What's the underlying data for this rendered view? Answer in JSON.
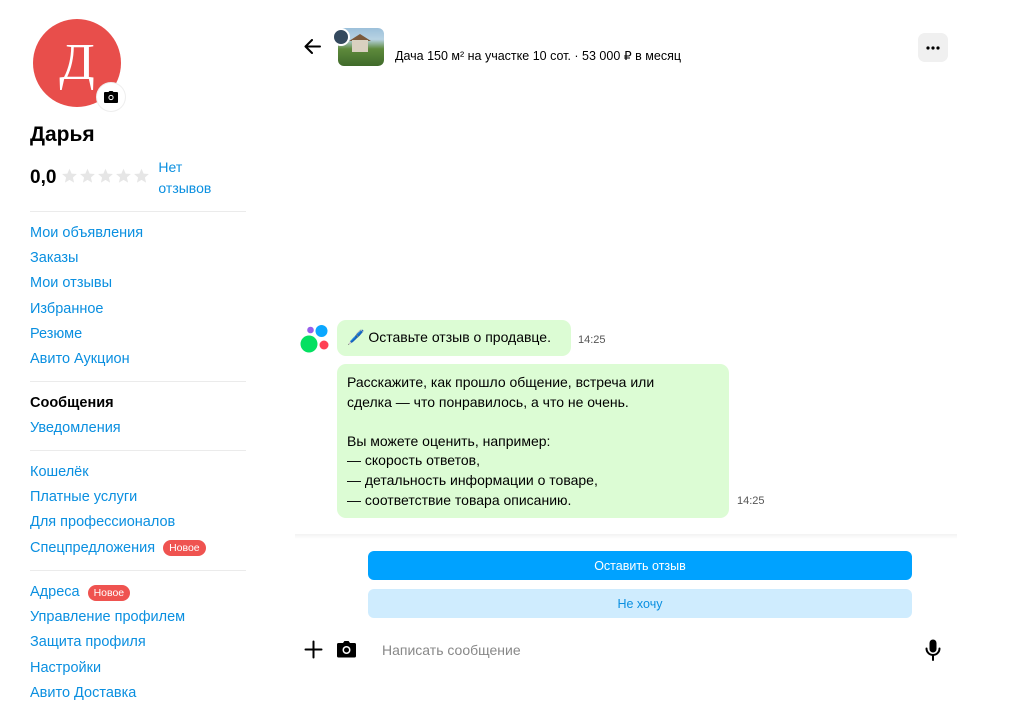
{
  "profile": {
    "avatar_letter": "Д",
    "name": "Дарья",
    "rating": "0,0",
    "stars_filled": 0,
    "stars_total": 5,
    "no_reviews": "Нет отзывов"
  },
  "menu": {
    "group1": [
      "Мои объявления",
      "Заказы",
      "Мои отзывы",
      "Избранное",
      "Резюме",
      "Авито Аукцион"
    ],
    "group2": [
      "Сообщения",
      "Уведомления"
    ],
    "group3": [
      "Кошелёк",
      "Платные услуги",
      "Для профессионалов",
      "Спецпредложения"
    ],
    "group4": [
      "Адреса",
      "Управление профилем",
      "Защита профиля",
      "Настройки",
      "Авито Доставка"
    ],
    "badge_new": "Новое"
  },
  "chat": {
    "header_title": "Дача 150 м² на участке 10 сот. · 53 000 ₽ в месяц",
    "message1": "🖊️ Оставьте отзыв о продавце.",
    "time1": "14:25",
    "message2_lines": [
      "Расскажите, как прошло общение, встреча или",
      "сделка — что понравилось, а что не очень.",
      "",
      "Вы можете оценить, например:",
      "— скорость ответов,",
      "— детальность информации о товаре,",
      "— соответствие товара описанию."
    ],
    "time2": "14:25",
    "btn_review": "Оставить отзыв",
    "btn_decline": "Не хочу",
    "input_placeholder": "Написать сообщение"
  },
  "colors": {
    "link": "#0a8fe0",
    "avatar": "#e84e4b",
    "bubble": "#dcfcd4",
    "primary_button": "#00a2ff",
    "secondary_button": "#cfecfe",
    "badge": "#ef5350"
  }
}
